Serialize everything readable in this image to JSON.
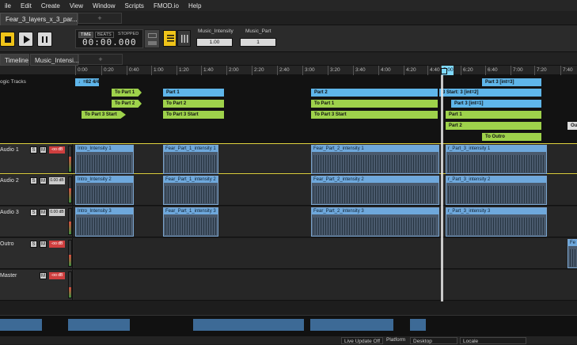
{
  "menu": [
    "ile",
    "Edit",
    "Create",
    "View",
    "Window",
    "Scripts",
    "FMOD.io",
    "Help"
  ],
  "doc_tab": "Fear_3_layers_x_3_par...",
  "new_tab": "+",
  "transport": {
    "mode_time": "TIME",
    "mode_beats": "BEATS",
    "state": "STOPPED",
    "clock": "00:00.000",
    "params": [
      {
        "name": "Music_Intensity",
        "value": "1.00"
      },
      {
        "name": "Music_Part",
        "value": "1"
      }
    ]
  },
  "timeline_tabs": [
    "Timeline",
    "Music_Intensi..."
  ],
  "ruler_ticks": [
    "0:00",
    "0:20",
    "0:40",
    "1:00",
    "1:20",
    "1:40",
    "2:00",
    "2:20",
    "2:40",
    "3:00",
    "3:20",
    "3:40",
    "4:00",
    "4:20",
    "4:40",
    "5:00",
    "6:20",
    "6:40",
    "7:00",
    "7:20",
    "7:40"
  ],
  "logic": {
    "label": "ogic Tracks",
    "tempo": "♩=82 4/4",
    "markers": [
      {
        "text": "To Part 1",
        "kind": "green"
      },
      {
        "text": "To Part 2",
        "kind": "green"
      },
      {
        "text": "To Part 3 Start",
        "kind": "green"
      },
      {
        "text": "Part 1",
        "kind": "blue"
      },
      {
        "text": "Part 2",
        "kind": "blue"
      },
      {
        "text": "Part 3 Start",
        "kind": "blue"
      },
      {
        "text": "Part 2",
        "kind": "blue"
      },
      {
        "text": "To Part 1",
        "kind": "green"
      },
      {
        "text": "To Part 3 Start",
        "kind": "green"
      },
      {
        "text": "Part 3 [int=3]",
        "kind": "blue"
      },
      {
        "text": "3 Start: 3 [int=2]",
        "kind": "blue"
      },
      {
        "text": "Part 3 [int=1]",
        "kind": "blue"
      },
      {
        "text": "Part 1",
        "kind": "green"
      },
      {
        "text": "Part 2",
        "kind": "green"
      },
      {
        "text": "To Outro",
        "kind": "green"
      },
      {
        "text": "Out",
        "kind": "grey"
      }
    ],
    "badge": "2"
  },
  "tracks": [
    {
      "name": "Audio 1",
      "s": "S",
      "m": "M",
      "vol": "-oo dB",
      "clips": [
        "Intro_Intensity 1",
        "Fear_Part_1_intensity 1",
        "Fear_Part_2_intensity 1",
        "r_Part_3_intensity 1"
      ]
    },
    {
      "name": "Audio 2",
      "s": "S",
      "m": "M",
      "vol": "0.00 dB",
      "clips": [
        "Intro_Intensity 2",
        "Fear_Part_1_intensity 2",
        "Fear_Part_2_intensity 2",
        "r_Part_3_intensity 2"
      ]
    },
    {
      "name": "Audio 3",
      "s": "S",
      "m": "M",
      "vol": "0.00 dB",
      "clips": [
        "Intro_Intensity 3",
        "Fear_Part_1_intensity 3",
        "Fear_Part_2_intensity 3",
        "r_Part_3_intensity 3"
      ]
    },
    {
      "name": "Outro",
      "s": "S",
      "m": "M",
      "vol": "-oo dB",
      "clips": [
        "Fe"
      ]
    },
    {
      "name": "Master",
      "m": "M",
      "vol": "-oo dB"
    }
  ],
  "status": {
    "live_update": "Live Update Off",
    "platform_label": "Platform",
    "platform_value": "Desktop",
    "locale_label": "Locale"
  },
  "colors": {
    "accent_blue": "#6ea8dc",
    "accent_green": "#9ed24b",
    "record": "#cf3f3f",
    "transport_yellow": "#f0c419"
  }
}
